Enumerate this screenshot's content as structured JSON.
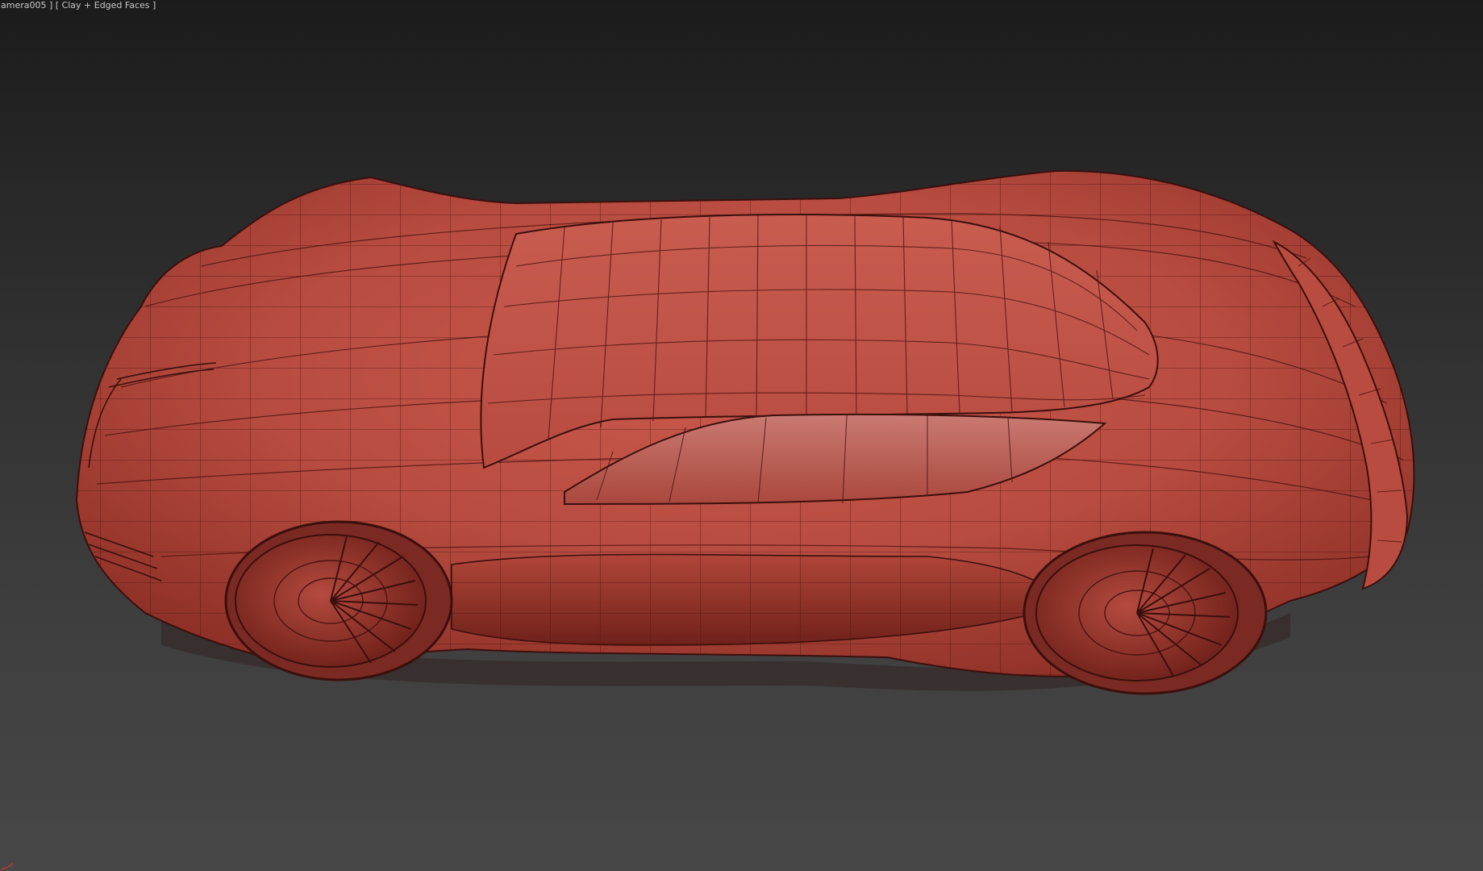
{
  "viewport": {
    "label": "amera005 ] [ Clay + Edged Faces ]",
    "background_top": "#1b1b1b",
    "background_bottom": "#474747"
  },
  "model": {
    "icon": "car-model",
    "clay_color": "#c2564a",
    "edge_color": "#4a1410"
  },
  "gizmo": {
    "icon": "axis-tripod-icon",
    "color": "#c83a2a"
  }
}
